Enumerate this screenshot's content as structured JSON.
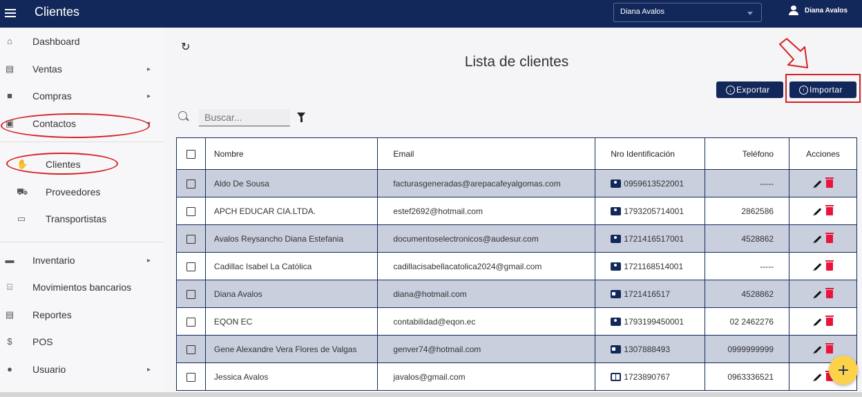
{
  "header": {
    "title": "Clientes",
    "user_select_value": "Diana Avalos",
    "user_name": "Diana Avalos"
  },
  "sidebar": {
    "items": [
      {
        "label": "Dashboard",
        "icon": "home-icon"
      },
      {
        "label": "Ventas",
        "icon": "register-icon",
        "has_submenu": true
      },
      {
        "label": "Compras",
        "icon": "bag-icon",
        "has_submenu": true
      },
      {
        "label": "Contactos",
        "icon": "contact-book-icon",
        "expanded": true
      },
      {
        "label": "Inventario",
        "icon": "inventory-icon",
        "has_submenu": true
      },
      {
        "label": "Movimientos bancarios",
        "icon": "bank-icon"
      },
      {
        "label": "Reportes",
        "icon": "report-icon"
      },
      {
        "label": "POS",
        "icon": "pos-icon"
      },
      {
        "label": "Usuario",
        "icon": "user-icon",
        "has_submenu": true
      }
    ],
    "contactos_sub": [
      {
        "label": "Clientes",
        "icon": "clients-icon",
        "active": true
      },
      {
        "label": "Proveedores",
        "icon": "truck-icon"
      },
      {
        "label": "Transportistas",
        "icon": "id-card-icon"
      }
    ]
  },
  "main": {
    "title": "Lista de clientes",
    "export_label": "Exportar",
    "import_label": "Importar",
    "search_placeholder": "Buscar..."
  },
  "table": {
    "headers": {
      "name": "Nombre",
      "email": "Email",
      "id": "Nro Identificación",
      "phone": "Teléfono",
      "actions": "Acciones"
    },
    "rows": [
      {
        "name": "Aldo De Sousa",
        "email": "facturasgeneradas@arepacafeyalgomas.com",
        "id": "0959613522001",
        "id_icon": "person-card",
        "phone": "-----"
      },
      {
        "name": "APCH EDUCAR CIA.LTDA.",
        "email": "estef2692@hotmail.com",
        "id": "1793205714001",
        "id_icon": "person-card",
        "phone": "2862586"
      },
      {
        "name": "Avalos Reysancho Diana Estefania",
        "email": "documentoselectronicos@audesur.com",
        "id": "1721416517001",
        "id_icon": "person-card",
        "phone": "4528862"
      },
      {
        "name": "Cadillac Isabel La Católica",
        "email": "cadillacisabellacatolica2024@gmail.com",
        "id": "1721168514001",
        "id_icon": "person-card",
        "phone": "-----"
      },
      {
        "name": "Diana Avalos",
        "email": "diana@hotmail.com",
        "id": "1721416517",
        "id_icon": "id-card",
        "phone": "4528862"
      },
      {
        "name": "EQON EC",
        "email": "contabilidad@eqon.ec",
        "id": "1793199450001",
        "id_icon": "person-card",
        "phone": "02 2462276"
      },
      {
        "name": "Gene Alexandre Vera Flores de Valgas",
        "email": "genver74@hotmail.com",
        "id": "1307888493",
        "id_icon": "id-card",
        "phone": "0999999999"
      },
      {
        "name": "Jessica Avalos",
        "email": "javalos@gmail.com",
        "id": "1723890767",
        "id_icon": "passport",
        "phone": "0963336521"
      }
    ]
  },
  "colors": {
    "primary": "#13285a",
    "row_alt": "#c9cfdd",
    "delete": "#e8143c",
    "fab": "#fdd24b",
    "annotation": "#d42020"
  }
}
